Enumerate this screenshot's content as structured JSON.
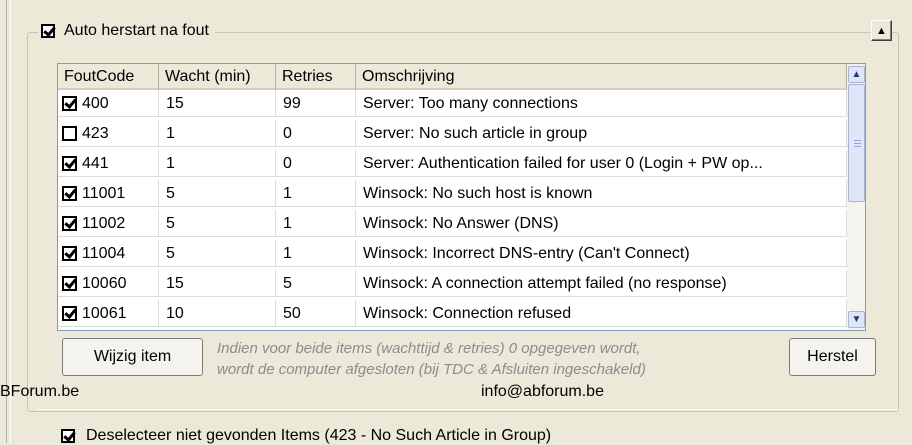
{
  "group": {
    "checkbox_checked": true,
    "title": "Auto herstart na fout",
    "scroll_up_icon": "triangle-up-icon"
  },
  "table": {
    "columns": [
      "FoutCode",
      "Wacht (min)",
      "Retries",
      "Omschrijving"
    ],
    "rows": [
      {
        "checked": true,
        "code": "400",
        "wait": "15",
        "retries": "99",
        "description": "Server: Too many connections"
      },
      {
        "checked": false,
        "code": "423",
        "wait": "1",
        "retries": "0",
        "description": "Server: No such article in group"
      },
      {
        "checked": true,
        "code": "441",
        "wait": "1",
        "retries": "0",
        "description": "Server: Authentication failed for user 0 (Login + PW op..."
      },
      {
        "checked": true,
        "code": "11001",
        "wait": "5",
        "retries": "1",
        "description": "Winsock: No such host is known"
      },
      {
        "checked": true,
        "code": "11002",
        "wait": "5",
        "retries": "1",
        "description": "Winsock: No Answer (DNS)"
      },
      {
        "checked": true,
        "code": "11004",
        "wait": "5",
        "retries": "1",
        "description": "Winsock: Incorrect DNS-entry (Can't Connect)"
      },
      {
        "checked": true,
        "code": "10060",
        "wait": "15",
        "retries": "5",
        "description": "Winsock: A connection attempt failed (no response)"
      },
      {
        "checked": true,
        "code": "10061",
        "wait": "10",
        "retries": "50",
        "description": "Winsock: Connection refused"
      }
    ]
  },
  "buttons": {
    "edit_item": "Wijzig item",
    "restore": "Herstel"
  },
  "info_text": {
    "line1": "Indien voor beide items (wachttijd & retries) 0 opgegeven wordt,",
    "line2": "wordt de computer afgesloten (bij TDC & Afsluiten ingeschakeld)"
  },
  "watermark": {
    "left": "BForum.be",
    "center": "info@abforum.be"
  },
  "bottom_option": {
    "checked": true,
    "label": "Deselecteer niet gevonden Items (423 - No Such Article in Group)"
  },
  "colors": {
    "window_bg": "#ece9d8",
    "info_text": "#8c8c8c",
    "scrollbar": "#dee6f7"
  }
}
